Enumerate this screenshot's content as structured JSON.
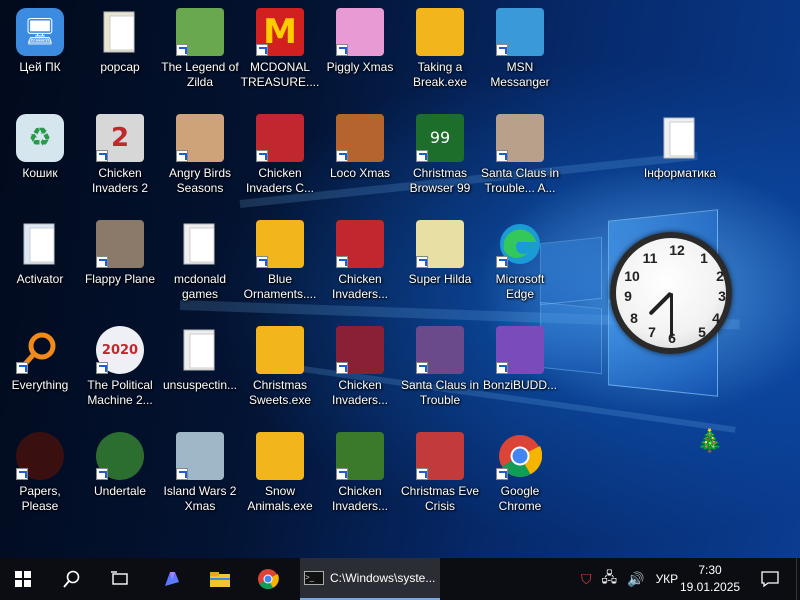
{
  "desktop": {
    "icons": [
      {
        "label": "Цей ПК",
        "icon": "this-pc-icon",
        "color": "#3b8be0",
        "glyph": "🖥",
        "shortcut": false
      },
      {
        "label": "popcap",
        "icon": "folder-icon",
        "color": "#e9e4d0",
        "glyph": "",
        "shortcut": false
      },
      {
        "label": "The Legend of Zilda",
        "icon": "zilda-game-icon",
        "color": "#6aa84f",
        "glyph": "",
        "shortcut": true
      },
      {
        "label": "MCDONAL TREASURE....",
        "icon": "mcdonalds-icon",
        "color": "#d21f1f",
        "glyph": "M",
        "shortcut": true
      },
      {
        "label": "Piggly Xmas",
        "icon": "piggly-icon",
        "color": "#e79ad3",
        "glyph": "",
        "shortcut": true
      },
      {
        "label": "Taking a Break.exe",
        "icon": "puzzle-exe-icon",
        "color": "#f2b51c",
        "glyph": "",
        "shortcut": false
      },
      {
        "label": "MSN Messanger",
        "icon": "msn-icon",
        "color": "#3a9ad9",
        "glyph": "",
        "shortcut": true
      },
      {
        "label": "Кошик",
        "icon": "recycle-bin-icon",
        "color": "#d6e6ee",
        "glyph": "♻",
        "shortcut": false
      },
      {
        "label": "Chicken Invaders 2",
        "icon": "chicken-invaders-2-icon",
        "color": "#d7d7d7",
        "glyph": "2",
        "shortcut": true
      },
      {
        "label": "Angry Birds Seasons",
        "icon": "angry-birds-icon",
        "color": "#cfa37a",
        "glyph": "",
        "shortcut": true
      },
      {
        "label": "Chicken Invaders C...",
        "icon": "chicken-invaders-christmas-icon",
        "color": "#c0282d",
        "glyph": "",
        "shortcut": true
      },
      {
        "label": "Loco Xmas",
        "icon": "loco-xmas-icon",
        "color": "#b5642d",
        "glyph": "",
        "shortcut": true
      },
      {
        "label": "Christmas Browser 99",
        "icon": "christmas-tree-icon",
        "color": "#1d6e2a",
        "glyph": "99",
        "shortcut": true
      },
      {
        "label": "Santa Claus in Trouble... A...",
        "icon": "santa-icon",
        "color": "#b9a08a",
        "glyph": "",
        "shortcut": true
      },
      {
        "label": "Інформатика",
        "icon": "folder-icon",
        "color": "#eef0f3",
        "glyph": "",
        "shortcut": false
      },
      {
        "label": "Activator",
        "icon": "folder-icon",
        "color": "#dbe9f7",
        "glyph": "",
        "shortcut": false
      },
      {
        "label": "Flappy Plane",
        "icon": "flappy-plane-icon",
        "color": "#8b7a6a",
        "glyph": "",
        "shortcut": true
      },
      {
        "label": "mcdonald games",
        "icon": "folder-icon",
        "color": "#eeeeee",
        "glyph": "",
        "shortcut": false
      },
      {
        "label": "Blue Ornaments....",
        "icon": "puzzle-exe-icon",
        "color": "#f2b51c",
        "glyph": "",
        "shortcut": true
      },
      {
        "label": "Chicken Invaders...",
        "icon": "chicken-invaders-icon",
        "color": "#c0282d",
        "glyph": "",
        "shortcut": true
      },
      {
        "label": "Super Hilda",
        "icon": "super-hilda-icon",
        "color": "#e8dfa4",
        "glyph": "",
        "shortcut": true
      },
      {
        "label": "Microsoft Edge",
        "icon": "edge-icon",
        "color": "#1b9bd6",
        "glyph": "",
        "shortcut": true
      },
      {
        "label": "Everything",
        "icon": "everything-icon",
        "color": "#00000000",
        "glyph": "",
        "shortcut": true
      },
      {
        "label": "The Political Machine 2...",
        "icon": "political-machine-icon",
        "color": "#eef0f5",
        "glyph": "2020",
        "shortcut": true
      },
      {
        "label": "unsuspectin...",
        "icon": "folder-icon",
        "color": "#eeeeee",
        "glyph": "",
        "shortcut": false
      },
      {
        "label": "Christmas Sweets.exe",
        "icon": "puzzle-exe-icon",
        "color": "#f2b51c",
        "glyph": "",
        "shortcut": false
      },
      {
        "label": "Chicken Invaders...",
        "icon": "chicken-invaders-icon",
        "color": "#8a2035",
        "glyph": "",
        "shortcut": true
      },
      {
        "label": "Santa Claus in Trouble",
        "icon": "santa-icon",
        "color": "#6a4a8a",
        "glyph": "",
        "shortcut": true
      },
      {
        "label": "BonziBUDD...",
        "icon": "bonzibuddy-icon",
        "color": "#7a4bbb",
        "glyph": "",
        "shortcut": true
      },
      {
        "label": "Papers, Please",
        "icon": "papers-please-icon",
        "color": "#3a0f0f",
        "glyph": "",
        "shortcut": true
      },
      {
        "label": "Undertale",
        "icon": "undertale-icon",
        "color": "#2c6e2f",
        "glyph": "",
        "shortcut": true
      },
      {
        "label": "Island Wars 2 Xmas",
        "icon": "island-wars-icon",
        "color": "#9fb8c8",
        "glyph": "",
        "shortcut": true
      },
      {
        "label": "Snow Animals.exe",
        "icon": "puzzle-exe-icon",
        "color": "#f2b51c",
        "glyph": "",
        "shortcut": false
      },
      {
        "label": "Chicken Invaders...",
        "icon": "chicken-invaders-icon",
        "color": "#3a7a2a",
        "glyph": "",
        "shortcut": true
      },
      {
        "label": "Christmas Eve Crisis",
        "icon": "santa-icon",
        "color": "#c23a3a",
        "glyph": "",
        "shortcut": true
      },
      {
        "label": "Google Chrome",
        "icon": "chrome-icon",
        "color": "#ffffff",
        "glyph": "",
        "shortcut": true
      }
    ],
    "clock_gadget": {
      "hour": 7,
      "minute": 30
    }
  },
  "taskbar": {
    "start_icon": "windows-start-icon",
    "search_icon": "search-icon",
    "task_view_icon": "task-view-icon",
    "copilot_icon": "copilot-icon",
    "explorer_icon": "file-explorer-icon",
    "chrome_icon": "chrome-icon",
    "cmd_label": "C:\\Windows\\syste...",
    "language": "УКР",
    "time": "7:30",
    "date": "19.01.2025"
  }
}
